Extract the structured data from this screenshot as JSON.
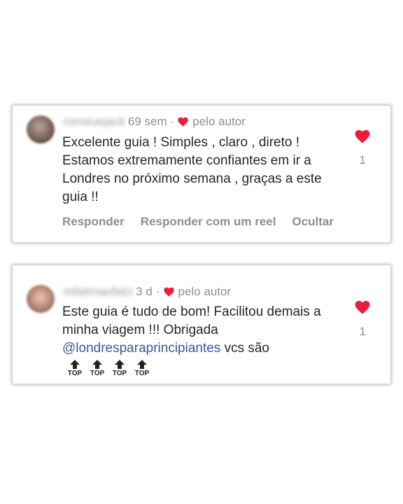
{
  "comments": [
    {
      "username": "romeuejack",
      "time": "69 sem",
      "separator": "·",
      "author_like_text": "pelo autor",
      "text": "Excelente guia ! Simples , claro , direto ! Estamos extremamente confiantes em ir a Londres no próximo semana , graças a este guia !!",
      "likes": "1",
      "actions": {
        "reply": "Responder",
        "reply_reel": "Responder com um reel",
        "hide": "Ocultar"
      }
    },
    {
      "username": "mfatimavfalci",
      "time": "3 d",
      "separator": "·",
      "author_like_text": "pelo autor",
      "text_before_mention": "Este guia é tudo de bom! Facilitou demais a minha viagem !!! Obrigada ",
      "mention": "@londresparaprincipiantes",
      "text_after_mention": " vcs são",
      "likes": "1",
      "top_badges": [
        "TOP",
        "TOP",
        "TOP",
        "TOP"
      ]
    }
  ],
  "colors": {
    "heart": "#ed1c3c",
    "meta": "#8e8e8e",
    "text": "#262626",
    "mention": "#385898"
  },
  "icons": {
    "author_like": "heart-icon",
    "like": "heart-icon",
    "top_badge": "up-arrow-icon"
  }
}
